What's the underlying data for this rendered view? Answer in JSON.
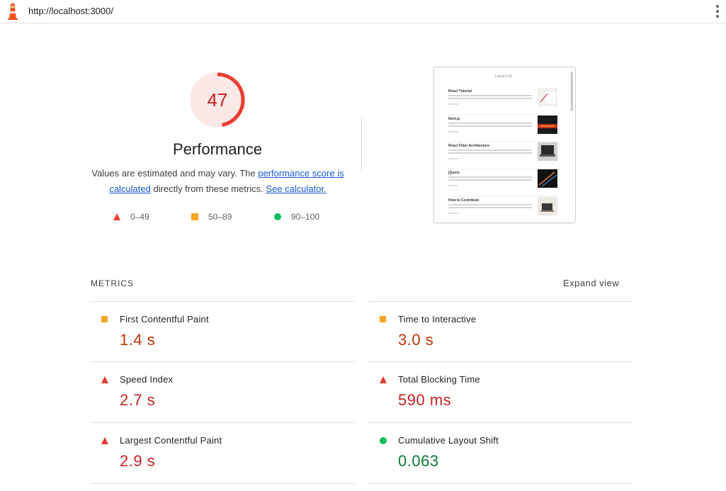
{
  "browser": {
    "url": "http://localhost:3000/"
  },
  "performance": {
    "score": "47",
    "score_value": 47,
    "title": "Performance",
    "desc_text_1": "Values are estimated and may vary. The ",
    "desc_link_1": "performance score is calculated",
    "desc_text_2": " directly from these metrics. ",
    "desc_link_2": "See calculator.",
    "colors": {
      "fail": "#eb3b2f",
      "average": "#f5a623",
      "pass": "#0bbe5c"
    }
  },
  "legend": [
    {
      "label": "0–49",
      "icon": "red-triangle-icon"
    },
    {
      "label": "50–89",
      "icon": "orange-square-icon"
    },
    {
      "label": "90–100",
      "icon": "green-circle-icon"
    }
  ],
  "screenshot": {
    "title": "Laney's UI",
    "items": [
      {
        "title": "React Tutorial"
      },
      {
        "title": "Next.js"
      },
      {
        "title": "React Fiber Architecture"
      },
      {
        "title": "jQuery"
      },
      {
        "title": "How to Contribute"
      }
    ]
  },
  "metrics": {
    "header": "METRICS",
    "expand_label": "Expand view",
    "items": [
      {
        "name": "First Contentful Paint",
        "value": "1.4 s",
        "rating": "average",
        "icon": "orange-square-icon"
      },
      {
        "name": "Time to Interactive",
        "value": "3.0 s",
        "rating": "average",
        "icon": "orange-square-icon"
      },
      {
        "name": "Speed Index",
        "value": "2.7 s",
        "rating": "fail",
        "icon": "red-triangle-icon"
      },
      {
        "name": "Total Blocking Time",
        "value": "590 ms",
        "rating": "fail",
        "icon": "red-triangle-icon"
      },
      {
        "name": "Largest Contentful Paint",
        "value": "2.9 s",
        "rating": "fail",
        "icon": "red-triangle-icon"
      },
      {
        "name": "Cumulative Layout Shift",
        "value": "0.063",
        "rating": "pass",
        "icon": "green-circle-icon"
      }
    ]
  }
}
